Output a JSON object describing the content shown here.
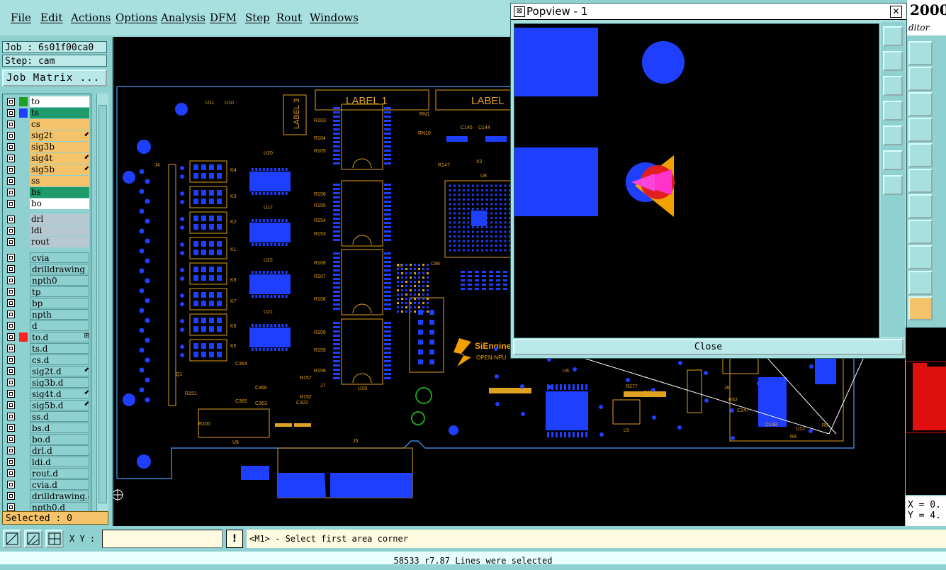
{
  "menu": {
    "items": [
      "File",
      "Edit",
      "Actions",
      "Options",
      "Analysis",
      "DFM",
      "Step",
      "Rout",
      "Windows"
    ]
  },
  "job": {
    "job_label": "Job : 6s01f00ca0",
    "step_label": "Step: cam",
    "matrix_button": "Job Matrix ..."
  },
  "layers": [
    {
      "name": "to",
      "color": "#ffffff",
      "swatch": "#1fa01f"
    },
    {
      "name": "ts",
      "color": "#1f9a6a",
      "swatch": "#1f3fff"
    },
    {
      "name": "cs",
      "color": "#f5c46a",
      "swatch": ""
    },
    {
      "name": "sig2t",
      "color": "#f5c46a",
      "swatch": "",
      "flag": "⬋"
    },
    {
      "name": "sig3b",
      "color": "#f5c46a",
      "swatch": ""
    },
    {
      "name": "sig4t",
      "color": "#f5c46a",
      "swatch": "",
      "flag": "⬋"
    },
    {
      "name": "sig5b",
      "color": "#f5c46a",
      "swatch": "",
      "flag": "⬋"
    },
    {
      "name": "ss",
      "color": "#f5c46a",
      "swatch": ""
    },
    {
      "name": "bs",
      "color": "#1f9a6a",
      "swatch": ""
    },
    {
      "name": "bo",
      "color": "#ffffff",
      "swatch": ""
    },
    {
      "name": "drl",
      "color": "#b8c8d0",
      "swatch": ""
    },
    {
      "name": "ldi",
      "color": "#b8c8d0",
      "swatch": ""
    },
    {
      "name": "rout",
      "color": "#b8c8d0",
      "swatch": ""
    },
    {
      "name": "cvia",
      "color": "#8fd0d0",
      "swatch": ""
    },
    {
      "name": "drilldrawing",
      "color": "#8fd0d0",
      "swatch": ""
    },
    {
      "name": "npth0",
      "color": "#8fd0d0",
      "swatch": ""
    },
    {
      "name": "tp",
      "color": "#8fd0d0",
      "swatch": ""
    },
    {
      "name": "bp",
      "color": "#8fd0d0",
      "swatch": ""
    },
    {
      "name": "npth",
      "color": "#8fd0d0",
      "swatch": ""
    },
    {
      "name": "d",
      "color": "#8fd0d0",
      "swatch": ""
    },
    {
      "name": "to.d",
      "color": "#8fd0d0",
      "swatch": "#ff2020",
      "flag": "⊞"
    },
    {
      "name": "ts.d",
      "color": "#8fd0d0",
      "swatch": ""
    },
    {
      "name": "cs.d",
      "color": "#8fd0d0",
      "swatch": ""
    },
    {
      "name": "sig2t.d",
      "color": "#8fd0d0",
      "swatch": "",
      "flag": "⬋"
    },
    {
      "name": "sig3b.d",
      "color": "#8fd0d0",
      "swatch": ""
    },
    {
      "name": "sig4t.d",
      "color": "#8fd0d0",
      "swatch": "",
      "flag": "⬋"
    },
    {
      "name": "sig5b.d",
      "color": "#8fd0d0",
      "swatch": "",
      "flag": "⬋"
    },
    {
      "name": "ss.d",
      "color": "#8fd0d0",
      "swatch": ""
    },
    {
      "name": "bs.d",
      "color": "#8fd0d0",
      "swatch": ""
    },
    {
      "name": "bo.d",
      "color": "#8fd0d0",
      "swatch": ""
    },
    {
      "name": "drl.d",
      "color": "#8fd0d0",
      "swatch": ""
    },
    {
      "name": "ldi.d",
      "color": "#8fd0d0",
      "swatch": ""
    },
    {
      "name": "rout.d",
      "color": "#8fd0d0",
      "swatch": ""
    },
    {
      "name": "cvia.d",
      "color": "#8fd0d0",
      "swatch": ""
    },
    {
      "name": "drilldrawing.d",
      "color": "#8fd0d0",
      "swatch": ""
    },
    {
      "name": "npth0.d",
      "color": "#8fd0d0",
      "swatch": ""
    }
  ],
  "selected_label": "Selected : 0",
  "board": {
    "label1": "LABEL 1",
    "label2": "LABEL",
    "label3": "LABEL 3",
    "refdes": [
      "U11",
      "U10",
      "J4",
      "U20",
      "U17",
      "U22",
      "U21",
      "K4",
      "K3",
      "K2",
      "K1",
      "K8",
      "K7",
      "K6",
      "K5",
      "R103",
      "R104",
      "R105",
      "R156",
      "R155",
      "R154",
      "R153",
      "R106",
      "R107",
      "R108",
      "R109",
      "R159",
      "R158",
      "R157",
      "R152",
      "U5",
      "U19",
      "J5",
      "J7",
      "U9",
      "C364",
      "C365",
      "C363",
      "C322",
      "C366",
      "R200",
      "R151",
      "Q1",
      "RN1",
      "RN10",
      "C145",
      "C144",
      "X2",
      "U8",
      "R147",
      "C86",
      "U6",
      "R277",
      "R164",
      "C324",
      "L5",
      "J6",
      "R32",
      "C147",
      "C148",
      "U12",
      "R5",
      "R9"
    ],
    "logo_text": "SiEngine",
    "logo_sub": "OPEN-NPU"
  },
  "popview": {
    "title": "Popview - 1",
    "close_label": "Close"
  },
  "right": {
    "title_a": "2000",
    "title_b": "ditor",
    "x_readout": "X = 0.",
    "y_readout": "Y = 4."
  },
  "bottom": {
    "xy_label": "X Y :",
    "excl": "!",
    "prompt": "<M1> - Select first area corner",
    "status": "58533 r7.87 Lines were selected"
  },
  "colors": {
    "copper": "#1f3fff",
    "silk": "#e0a020",
    "outline": "#4aa0ff",
    "magenta": "#ff33cc",
    "red": "#e02020",
    "orange": "#f0a000"
  }
}
